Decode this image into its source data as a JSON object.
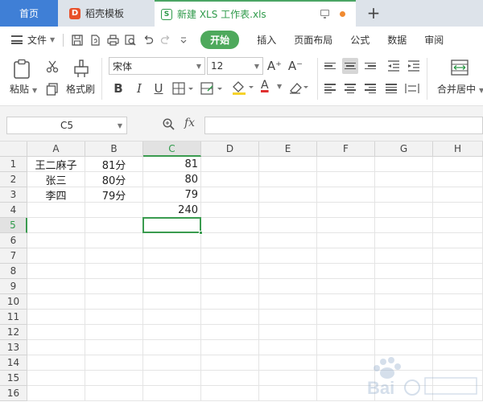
{
  "tabs": {
    "home": "首页",
    "template": "稻壳模板",
    "doc_title": "新建 XLS 工作表.xls",
    "add": "+",
    "template_logo": "D",
    "doc_logo": "S"
  },
  "menu": {
    "file": "文件",
    "start": "开始",
    "items": [
      "插入",
      "页面布局",
      "公式",
      "数据",
      "审阅"
    ]
  },
  "ribbon": {
    "paste": "粘贴",
    "format_painter": "格式刷",
    "font_name": "宋体",
    "font_size": "12",
    "font_grow": "A⁺",
    "font_shrink": "A⁻",
    "bold": "B",
    "italic": "I",
    "underline": "U",
    "font_color_glyph": "A",
    "merge_center": "合并居中"
  },
  "formula_bar": {
    "cell_ref": "C5",
    "fx": "fx",
    "formula": ""
  },
  "columns": [
    "A",
    "B",
    "C",
    "D",
    "E",
    "F",
    "G",
    "H"
  ],
  "rows": [
    "1",
    "2",
    "3",
    "4",
    "5",
    "6",
    "7",
    "8",
    "9",
    "10",
    "11",
    "12",
    "13",
    "14",
    "15",
    "16"
  ],
  "cells": [
    {
      "ref": "A1",
      "value": "王二麻子"
    },
    {
      "ref": "B1",
      "value": "81分"
    },
    {
      "ref": "C1",
      "value": "81"
    },
    {
      "ref": "A2",
      "value": "张三"
    },
    {
      "ref": "B2",
      "value": "80分"
    },
    {
      "ref": "C2",
      "value": "80"
    },
    {
      "ref": "A3",
      "value": "李四"
    },
    {
      "ref": "B3",
      "value": "79分"
    },
    {
      "ref": "C3",
      "value": "79"
    },
    {
      "ref": "C4",
      "value": "240"
    }
  ],
  "selected_cell": "C5",
  "colors": {
    "accent_green": "#4ea95c",
    "home_tab_blue": "#3f7fd6",
    "selection_green": "#3a9b4f",
    "template_logo": "#e8502a",
    "unsaved_dot": "#f08a30"
  }
}
